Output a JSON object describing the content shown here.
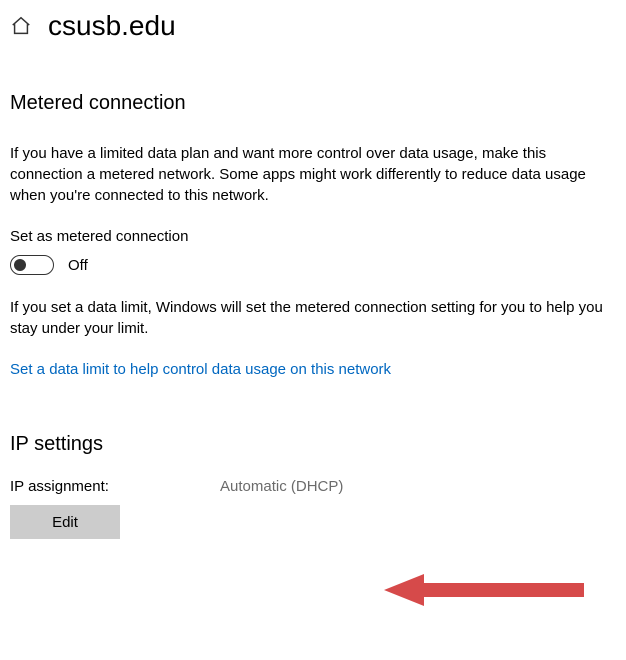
{
  "header": {
    "title": "csusb.edu"
  },
  "metered": {
    "heading": "Metered connection",
    "description": "If you have a limited data plan and want more control over data usage, make this connection a metered network. Some apps might work differently to reduce data usage when you're connected to this network.",
    "toggle_label": "Set as metered connection",
    "toggle_state": "Off",
    "limit_note": "If you set a data limit, Windows will set the metered connection setting for you to help you stay under your limit.",
    "link_text": "Set a data limit to help control data usage on this network"
  },
  "ip": {
    "heading": "IP settings",
    "assignment_label": "IP assignment:",
    "assignment_value": "Automatic (DHCP)",
    "edit_label": "Edit"
  },
  "colors": {
    "link": "#0067c0",
    "muted": "#6b6b6b",
    "button_bg": "#cccccc",
    "arrow": "#d64a4a"
  }
}
